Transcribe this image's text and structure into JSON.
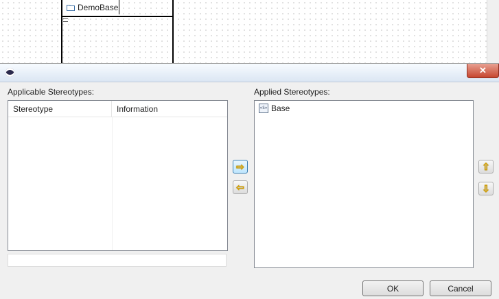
{
  "diagram": {
    "class_name": "DemoBase",
    "folder_icon": "folder-icon"
  },
  "dialog": {
    "app_icon": "eclipse-icon",
    "close_label": "✕",
    "applicable_label": "Applicable Stereotypes:",
    "applied_label": "Applied Stereotypes:",
    "columns": [
      "Stereotype",
      "Information"
    ],
    "applicable_rows": [],
    "filter_value": "",
    "applied_items": [
      {
        "label": "Base",
        "icon": "stereotype-icon"
      }
    ],
    "add_arrow": "⇨",
    "remove_arrow": "⇦",
    "up_arrow": "⇧",
    "down_arrow": "⇩",
    "ok_label": "OK",
    "cancel_label": "Cancel"
  },
  "colors": {
    "accent": "#3c7fb1",
    "arrow": "#d9a400",
    "close": "#c6462f"
  }
}
